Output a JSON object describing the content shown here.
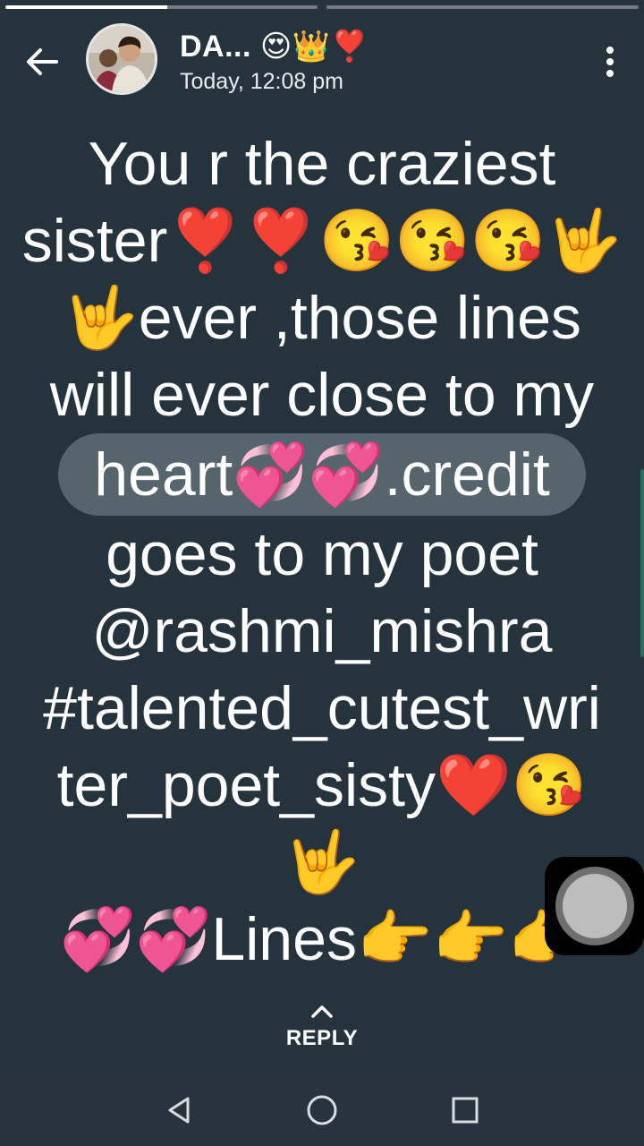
{
  "progress": {
    "segments": [
      {
        "fill": 0.52
      },
      {
        "fill": 0.0
      }
    ]
  },
  "header": {
    "contact_name": "DA...",
    "name_emoji": "😍👑❣️",
    "timestamp": "Today, 12:08 pm"
  },
  "status": {
    "lines": [
      "You r the craziest",
      "sister❣️❣️😘😘😘🤟",
      "🤟ever ,those lines",
      "will ever close to my",
      "heart💞💞.credit",
      "goes to my poet",
      "@rashmi_mishra",
      "#talented_cutest_wri",
      "ter_poet_sisty❤️😘",
      "🤟",
      "💞💞Lines👉👉👉"
    ]
  },
  "reply": {
    "label": "REPLY"
  },
  "icons": {
    "back": "back-arrow-icon",
    "menu": "more-vert-icon",
    "reply": "chevron-up-icon",
    "nav_back": "triangle-back-icon",
    "nav_home": "circle-home-icon",
    "nav_recents": "square-recents-icon"
  },
  "colors": {
    "background": "#25333d",
    "highlight": "#56646c",
    "text": "#ffffff"
  }
}
